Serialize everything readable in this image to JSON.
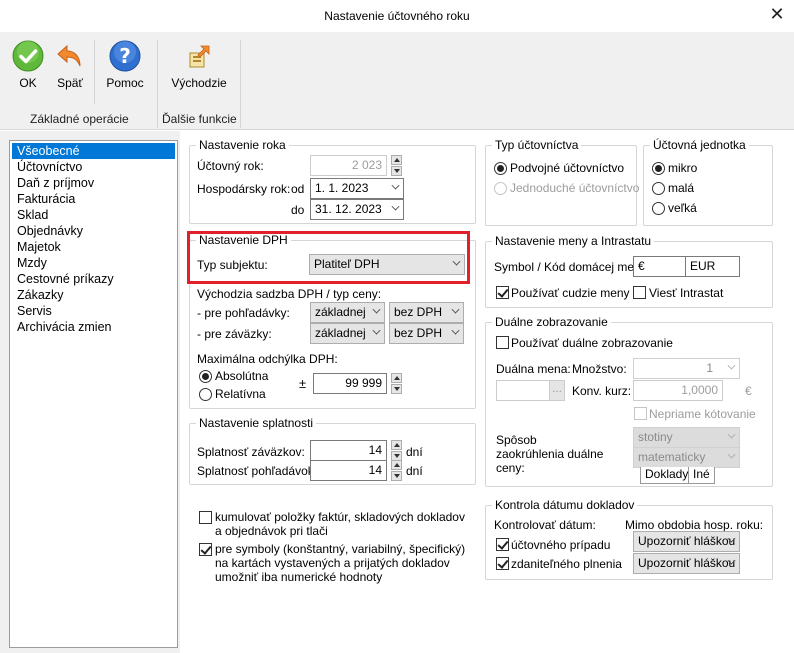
{
  "window": {
    "title": "Nastavenie účtovného roku",
    "close": "✕"
  },
  "ribbon": {
    "ok": "OK",
    "back": "Späť",
    "help": "Pomoc",
    "defaults": "Východzie",
    "group_basic": "Základné operácie",
    "group_more": "Ďalšie funkcie"
  },
  "nav": {
    "items": [
      "Všeobecné",
      "Účtovníctvo",
      "Daň z príjmov",
      "Fakturácia",
      "Sklad",
      "Objednávky",
      "Majetok",
      "Mzdy",
      "Cestovné príkazy",
      "Zákazky",
      "Servis",
      "Archivácia zmien"
    ],
    "selected": 0
  },
  "year": {
    "legend": "Nastavenie roka",
    "fiscal_label": "Účtovný rok:",
    "fiscal_value": "2 023",
    "business_label": "Hospodársky rok:",
    "from_label": "od",
    "from_value": "1.   1. 2023",
    "to_label": "do",
    "to_value": "31. 12. 2023"
  },
  "vat": {
    "legend": "Nastavenie DPH",
    "subject_label": "Typ subjektu:",
    "subject_value": "Platiteľ DPH",
    "rate_label": "Východzia sadzba DPH / typ ceny:",
    "receivables_label": "- pre pohľadávky:",
    "receivables_rate": "základnej",
    "receivables_type": "bez DPH",
    "liabilities_label": "- pre záväzky:",
    "liabilities_rate": "základnej",
    "liabilities_type": "bez DPH",
    "deviation_label": "Maximálna odchýlka DPH:",
    "absolute": "Absolútna",
    "relative": "Relatívna",
    "plusminus": "±",
    "deviation_value": "99 999"
  },
  "due": {
    "legend": "Nastavenie splatnosti",
    "liab_label": "Splatnosť záväzkov:",
    "liab_value": "14",
    "liab_unit": "dní",
    "recv_label": "Splatnosť pohľadávok:",
    "recv_value": "14",
    "recv_unit": "dní"
  },
  "options": {
    "opt1": "kumulovať položky faktúr, skladových dokladov a objednávok pri tlači",
    "opt2": "pre symboly (konštantný, variabilný, špecifický) na kartách vystavených a prijatých dokladov umožniť iba numerické hodnoty"
  },
  "accounting_type": {
    "legend": "Typ účtovníctva",
    "double": "Podvojné účtovníctvo",
    "single": "Jednoduché účtovníctvo"
  },
  "unit": {
    "legend": "Účtovná jednotka",
    "micro": "mikro",
    "small": "malá",
    "large": "veľká"
  },
  "currency": {
    "legend": "Nastavenie meny a Intrastatu",
    "symbol_label": "Symbol / Kód domácej meny:",
    "symbol": "€",
    "code": "EUR",
    "foreign": "Používať cudzie meny",
    "intrastat": "Viesť Intrastat"
  },
  "dual": {
    "legend": "Duálne zobrazovanie",
    "use": "Používať duálne zobrazovanie",
    "currency_label": "Duálna mena:",
    "qty_label": "Množstvo:",
    "qty_value": "1",
    "rate_label": "Konv. kurz:",
    "rate_value": "1,0000",
    "euro": "€",
    "indirect": "Nepriame kótovanie",
    "rounding_label": "Spôsob zaokrúhlenia duálne ceny:",
    "round1": "stotiny",
    "round2": "matematicky",
    "tab_docs": "Doklady",
    "tab_other": "Iné",
    "dots": "..."
  },
  "date_check": {
    "legend": "Kontrola dátumu dokladov",
    "check_label": "Kontrolovať dátum:",
    "outside_label": "Mimo obdobia hosp. roku:",
    "accounting": "účtovného prípadu",
    "accounting_value": "Upozorniť hláškou",
    "taxable": "zdaniteľného plnenia",
    "taxable_value": "Upozorniť hláškou"
  }
}
